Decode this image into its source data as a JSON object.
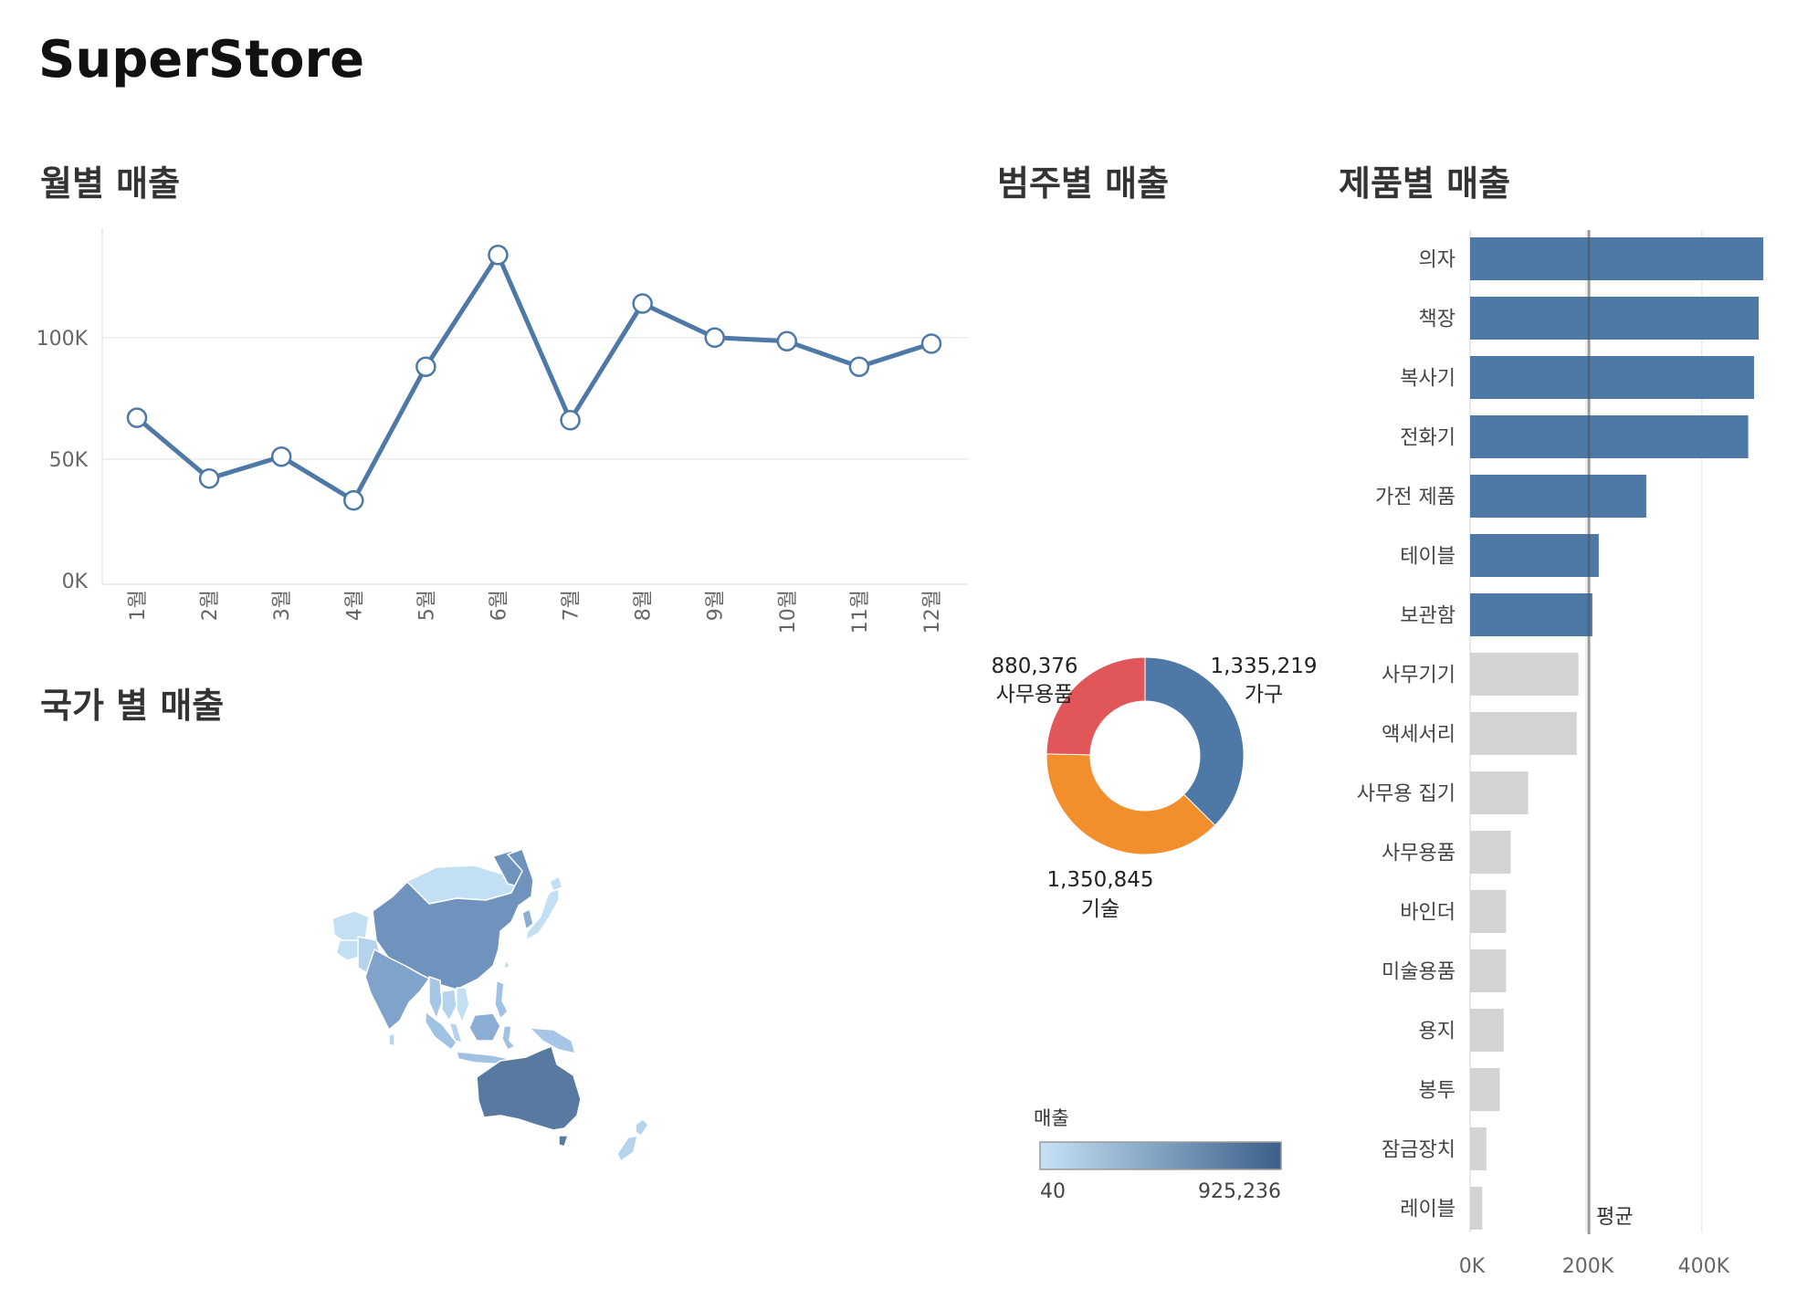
{
  "dashboard": {
    "title": "SuperStore"
  },
  "colors": {
    "primary_blue": "#4e79a7",
    "gray_bar": "#d3d3d3",
    "red": "#e15759",
    "orange": "#f28e2b",
    "gradient_low": "#c6e3f7",
    "gradient_high": "#3b5f8a",
    "grid": "#ebebeb",
    "axis_text": "#666666",
    "title_text": "#333333"
  },
  "chart_data": [
    {
      "id": "monthly",
      "type": "line",
      "title": "월별 매출",
      "categories": [
        "1월",
        "2월",
        "3월",
        "4월",
        "5월",
        "6월",
        "7월",
        "8월",
        "9월",
        "10월",
        "11월",
        "12월"
      ],
      "values": [
        67000,
        42000,
        51000,
        33000,
        88000,
        134000,
        66000,
        114000,
        100000,
        98500,
        88000,
        97500
      ],
      "ylim": [
        0,
        145000
      ],
      "yticks": [
        0,
        50000,
        100000
      ],
      "ytick_labels": [
        "0K",
        "50K",
        "100K"
      ],
      "grid": true
    },
    {
      "id": "category",
      "type": "pie",
      "title": "범주별 매출",
      "donut": true,
      "slices": [
        {
          "label": "가구",
          "value": 1335219,
          "value_label": "1,335,219",
          "color": "#4e79a7"
        },
        {
          "label": "기술",
          "value": 1350845,
          "value_label": "1,350,845",
          "color": "#f28e2b"
        },
        {
          "label": "사무용품",
          "value": 880376,
          "value_label": "880,376",
          "color": "#e15759"
        }
      ]
    },
    {
      "id": "product",
      "type": "bar",
      "orientation": "horizontal",
      "title": "제품별 매출",
      "categories": [
        "의자",
        "책장",
        "복사기",
        "전화기",
        "가전 제품",
        "테이블",
        "보관함",
        "사무기기",
        "액세서리",
        "사무용 집기",
        "사무용품",
        "바인더",
        "미술용품",
        "용지",
        "봉투",
        "잠금장치",
        "레이블"
      ],
      "values": [
        506000,
        498000,
        490000,
        480000,
        304000,
        222000,
        211000,
        187000,
        184000,
        100000,
        70000,
        62000,
        62000,
        58000,
        51000,
        28000,
        21000
      ],
      "highlighted": [
        true,
        true,
        true,
        true,
        true,
        true,
        true,
        false,
        false,
        false,
        false,
        false,
        false,
        false,
        false,
        false,
        false
      ],
      "xlim": [
        0,
        520000
      ],
      "xticks": [
        0,
        200000,
        400000
      ],
      "xtick_labels": [
        "0K",
        "200K",
        "400K"
      ],
      "reference_line": {
        "label": "평균",
        "value": 205000
      }
    },
    {
      "id": "country",
      "type": "map",
      "title": "국가 별 매출",
      "legend": {
        "title": "매출",
        "min_label": "40",
        "max_label": "925,236"
      }
    }
  ]
}
